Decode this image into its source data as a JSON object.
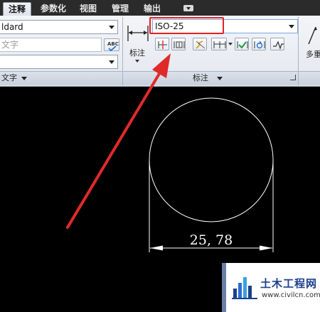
{
  "tabs": [
    {
      "label": "注释",
      "active": true
    },
    {
      "label": "参数化",
      "active": false
    },
    {
      "label": "视图",
      "active": false
    },
    {
      "label": "管理",
      "active": false
    },
    {
      "label": "输出",
      "active": false
    }
  ],
  "text_panel": {
    "style_value": "ldard",
    "text_placeholder": "文字",
    "footer_label": "文字"
  },
  "dim_panel": {
    "big_button_label": "标注",
    "style_value": "ISO-25",
    "footer_label": "标注"
  },
  "multileader_panel": {
    "label": "多重"
  },
  "drawing": {
    "dimension_text": "25, 78",
    "circle_color": "#ffffff",
    "arrow_color": "#e02a2a"
  },
  "watermark": {
    "title": "土木工程网",
    "url": "www.civilcn.com"
  }
}
